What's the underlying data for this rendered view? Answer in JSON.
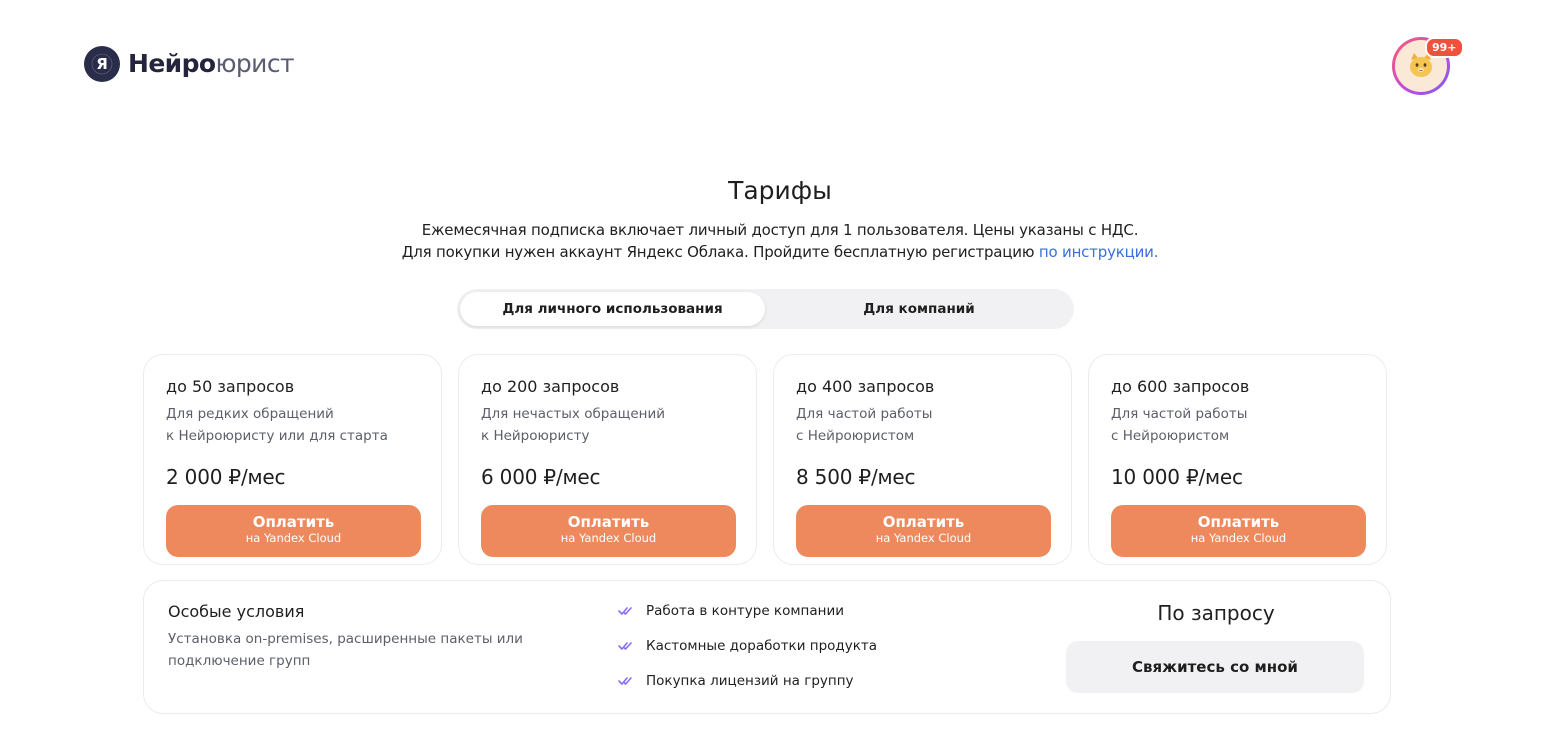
{
  "header": {
    "brand_part1": "Нейро",
    "brand_part2": "юрист",
    "notifications_badge": "99+"
  },
  "page": {
    "title": "Тарифы",
    "subtitle_line1": "Ежемесячная подписка включает личный доступ для 1 пользователя. Цены указаны с НДС.",
    "subtitle_line2": "Для покупки нужен аккаунт Яндекс Облака. Пройдите бесплатную регистрацию",
    "subtitle_link": "по инструкции."
  },
  "tabs": {
    "personal": "Для личного использования",
    "company": "Для компаний",
    "active": "personal"
  },
  "plans": [
    {
      "name": "до 50 запросов",
      "desc_line1": "Для редких обращений",
      "desc_line2": "к Нейроюристу или для старта",
      "price": "2 000 ₽/мес",
      "button_label": "Оплатить",
      "button_sub": "на Yandex Cloud"
    },
    {
      "name": "до 200 запросов",
      "desc_line1": "Для нечастых обращений",
      "desc_line2": "к Нейроюристу",
      "price": "6 000 ₽/мес",
      "button_label": "Оплатить",
      "button_sub": "на Yandex Cloud"
    },
    {
      "name": "до 400 запросов",
      "desc_line1": "Для частой работы",
      "desc_line2": "с Нейроюристом",
      "price": "8 500 ₽/мес",
      "button_label": "Оплатить",
      "button_sub": "на Yandex Cloud"
    },
    {
      "name": "до 600 запросов",
      "desc_line1": "Для частой работы",
      "desc_line2": "с Нейроюристом",
      "price": "10 000 ₽/мес",
      "button_label": "Оплатить",
      "button_sub": "на Yandex Cloud"
    }
  ],
  "special": {
    "title": "Особые условия",
    "desc": "Установка on-premises, расширенные пакеты или подключение групп",
    "features": [
      "Работа в контуре компании",
      "Кастомные доработки продукта",
      "Покупка лицензий на группу"
    ],
    "price": "По запросу",
    "button_label": "Свяжитесь со мной"
  },
  "icons": {
    "logo": "yandex-y-logo-icon",
    "avatar": "cat-avatar-icon",
    "feature_check": "double-check-icon"
  },
  "colors": {
    "accent_button": "#ed895c",
    "link": "#3a6fe0",
    "check": "#8b6cf0",
    "badge": "#f0503c"
  }
}
